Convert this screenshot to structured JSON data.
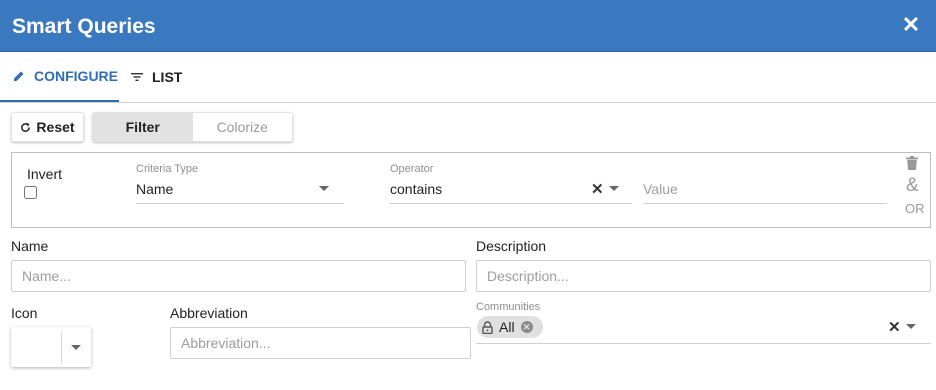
{
  "window": {
    "title": "Smart Queries"
  },
  "tabs": [
    {
      "label": "CONFIGURE",
      "icon": "pencil-icon",
      "active": true
    },
    {
      "label": "LIST",
      "icon": "filter-list-icon",
      "active": false
    }
  ],
  "toolbar": {
    "reset_label": "Reset",
    "segments": [
      {
        "label": "Filter",
        "selected": true
      },
      {
        "label": "Colorize",
        "selected": false
      }
    ]
  },
  "criteria": {
    "invert_label": "Invert",
    "invert_checked": false,
    "criteria_type_label": "Criteria Type",
    "criteria_type_value": "Name",
    "operator_label": "Operator",
    "operator_value": "contains",
    "value_placeholder": "Value",
    "and_label": "&",
    "or_label": "OR"
  },
  "form": {
    "name_label": "Name",
    "name_placeholder": "Name...",
    "description_label": "Description",
    "description_placeholder": "Description...",
    "icon_label": "Icon",
    "abbreviation_label": "Abbreviation",
    "abbreviation_placeholder": "Abbreviation...",
    "communities_label": "Communities",
    "communities_chip": "All"
  },
  "colors": {
    "header": "#3a78c0",
    "accent": "#2f6db5"
  }
}
